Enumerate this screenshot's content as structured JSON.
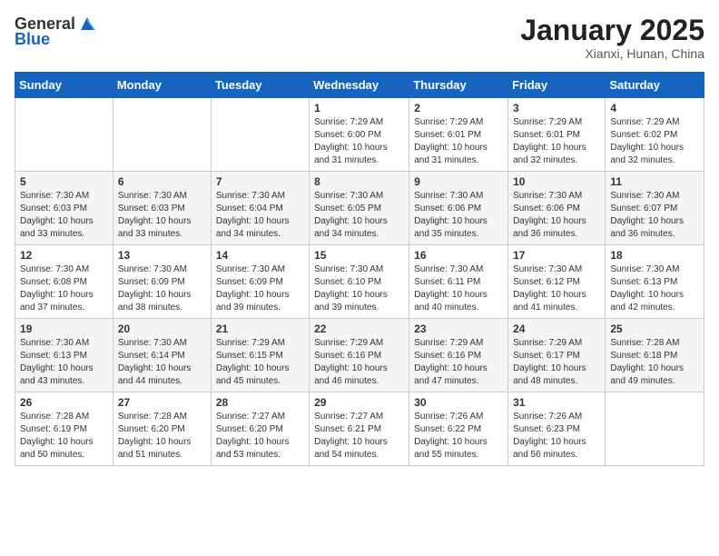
{
  "header": {
    "logo_general": "General",
    "logo_blue": "Blue",
    "month": "January 2025",
    "location": "Xianxi, Hunan, China"
  },
  "weekdays": [
    "Sunday",
    "Monday",
    "Tuesday",
    "Wednesday",
    "Thursday",
    "Friday",
    "Saturday"
  ],
  "weeks": [
    [
      {
        "day": "",
        "info": ""
      },
      {
        "day": "",
        "info": ""
      },
      {
        "day": "",
        "info": ""
      },
      {
        "day": "1",
        "info": "Sunrise: 7:29 AM\nSunset: 6:00 PM\nDaylight: 10 hours and 31 minutes."
      },
      {
        "day": "2",
        "info": "Sunrise: 7:29 AM\nSunset: 6:01 PM\nDaylight: 10 hours and 31 minutes."
      },
      {
        "day": "3",
        "info": "Sunrise: 7:29 AM\nSunset: 6:01 PM\nDaylight: 10 hours and 32 minutes."
      },
      {
        "day": "4",
        "info": "Sunrise: 7:29 AM\nSunset: 6:02 PM\nDaylight: 10 hours and 32 minutes."
      }
    ],
    [
      {
        "day": "5",
        "info": "Sunrise: 7:30 AM\nSunset: 6:03 PM\nDaylight: 10 hours and 33 minutes."
      },
      {
        "day": "6",
        "info": "Sunrise: 7:30 AM\nSunset: 6:03 PM\nDaylight: 10 hours and 33 minutes."
      },
      {
        "day": "7",
        "info": "Sunrise: 7:30 AM\nSunset: 6:04 PM\nDaylight: 10 hours and 34 minutes."
      },
      {
        "day": "8",
        "info": "Sunrise: 7:30 AM\nSunset: 6:05 PM\nDaylight: 10 hours and 34 minutes."
      },
      {
        "day": "9",
        "info": "Sunrise: 7:30 AM\nSunset: 6:06 PM\nDaylight: 10 hours and 35 minutes."
      },
      {
        "day": "10",
        "info": "Sunrise: 7:30 AM\nSunset: 6:06 PM\nDaylight: 10 hours and 36 minutes."
      },
      {
        "day": "11",
        "info": "Sunrise: 7:30 AM\nSunset: 6:07 PM\nDaylight: 10 hours and 36 minutes."
      }
    ],
    [
      {
        "day": "12",
        "info": "Sunrise: 7:30 AM\nSunset: 6:08 PM\nDaylight: 10 hours and 37 minutes."
      },
      {
        "day": "13",
        "info": "Sunrise: 7:30 AM\nSunset: 6:09 PM\nDaylight: 10 hours and 38 minutes."
      },
      {
        "day": "14",
        "info": "Sunrise: 7:30 AM\nSunset: 6:09 PM\nDaylight: 10 hours and 39 minutes."
      },
      {
        "day": "15",
        "info": "Sunrise: 7:30 AM\nSunset: 6:10 PM\nDaylight: 10 hours and 39 minutes."
      },
      {
        "day": "16",
        "info": "Sunrise: 7:30 AM\nSunset: 6:11 PM\nDaylight: 10 hours and 40 minutes."
      },
      {
        "day": "17",
        "info": "Sunrise: 7:30 AM\nSunset: 6:12 PM\nDaylight: 10 hours and 41 minutes."
      },
      {
        "day": "18",
        "info": "Sunrise: 7:30 AM\nSunset: 6:13 PM\nDaylight: 10 hours and 42 minutes."
      }
    ],
    [
      {
        "day": "19",
        "info": "Sunrise: 7:30 AM\nSunset: 6:13 PM\nDaylight: 10 hours and 43 minutes."
      },
      {
        "day": "20",
        "info": "Sunrise: 7:30 AM\nSunset: 6:14 PM\nDaylight: 10 hours and 44 minutes."
      },
      {
        "day": "21",
        "info": "Sunrise: 7:29 AM\nSunset: 6:15 PM\nDaylight: 10 hours and 45 minutes."
      },
      {
        "day": "22",
        "info": "Sunrise: 7:29 AM\nSunset: 6:16 PM\nDaylight: 10 hours and 46 minutes."
      },
      {
        "day": "23",
        "info": "Sunrise: 7:29 AM\nSunset: 6:16 PM\nDaylight: 10 hours and 47 minutes."
      },
      {
        "day": "24",
        "info": "Sunrise: 7:29 AM\nSunset: 6:17 PM\nDaylight: 10 hours and 48 minutes."
      },
      {
        "day": "25",
        "info": "Sunrise: 7:28 AM\nSunset: 6:18 PM\nDaylight: 10 hours and 49 minutes."
      }
    ],
    [
      {
        "day": "26",
        "info": "Sunrise: 7:28 AM\nSunset: 6:19 PM\nDaylight: 10 hours and 50 minutes."
      },
      {
        "day": "27",
        "info": "Sunrise: 7:28 AM\nSunset: 6:20 PM\nDaylight: 10 hours and 51 minutes."
      },
      {
        "day": "28",
        "info": "Sunrise: 7:27 AM\nSunset: 6:20 PM\nDaylight: 10 hours and 53 minutes."
      },
      {
        "day": "29",
        "info": "Sunrise: 7:27 AM\nSunset: 6:21 PM\nDaylight: 10 hours and 54 minutes."
      },
      {
        "day": "30",
        "info": "Sunrise: 7:26 AM\nSunset: 6:22 PM\nDaylight: 10 hours and 55 minutes."
      },
      {
        "day": "31",
        "info": "Sunrise: 7:26 AM\nSunset: 6:23 PM\nDaylight: 10 hours and 56 minutes."
      },
      {
        "day": "",
        "info": ""
      }
    ]
  ]
}
